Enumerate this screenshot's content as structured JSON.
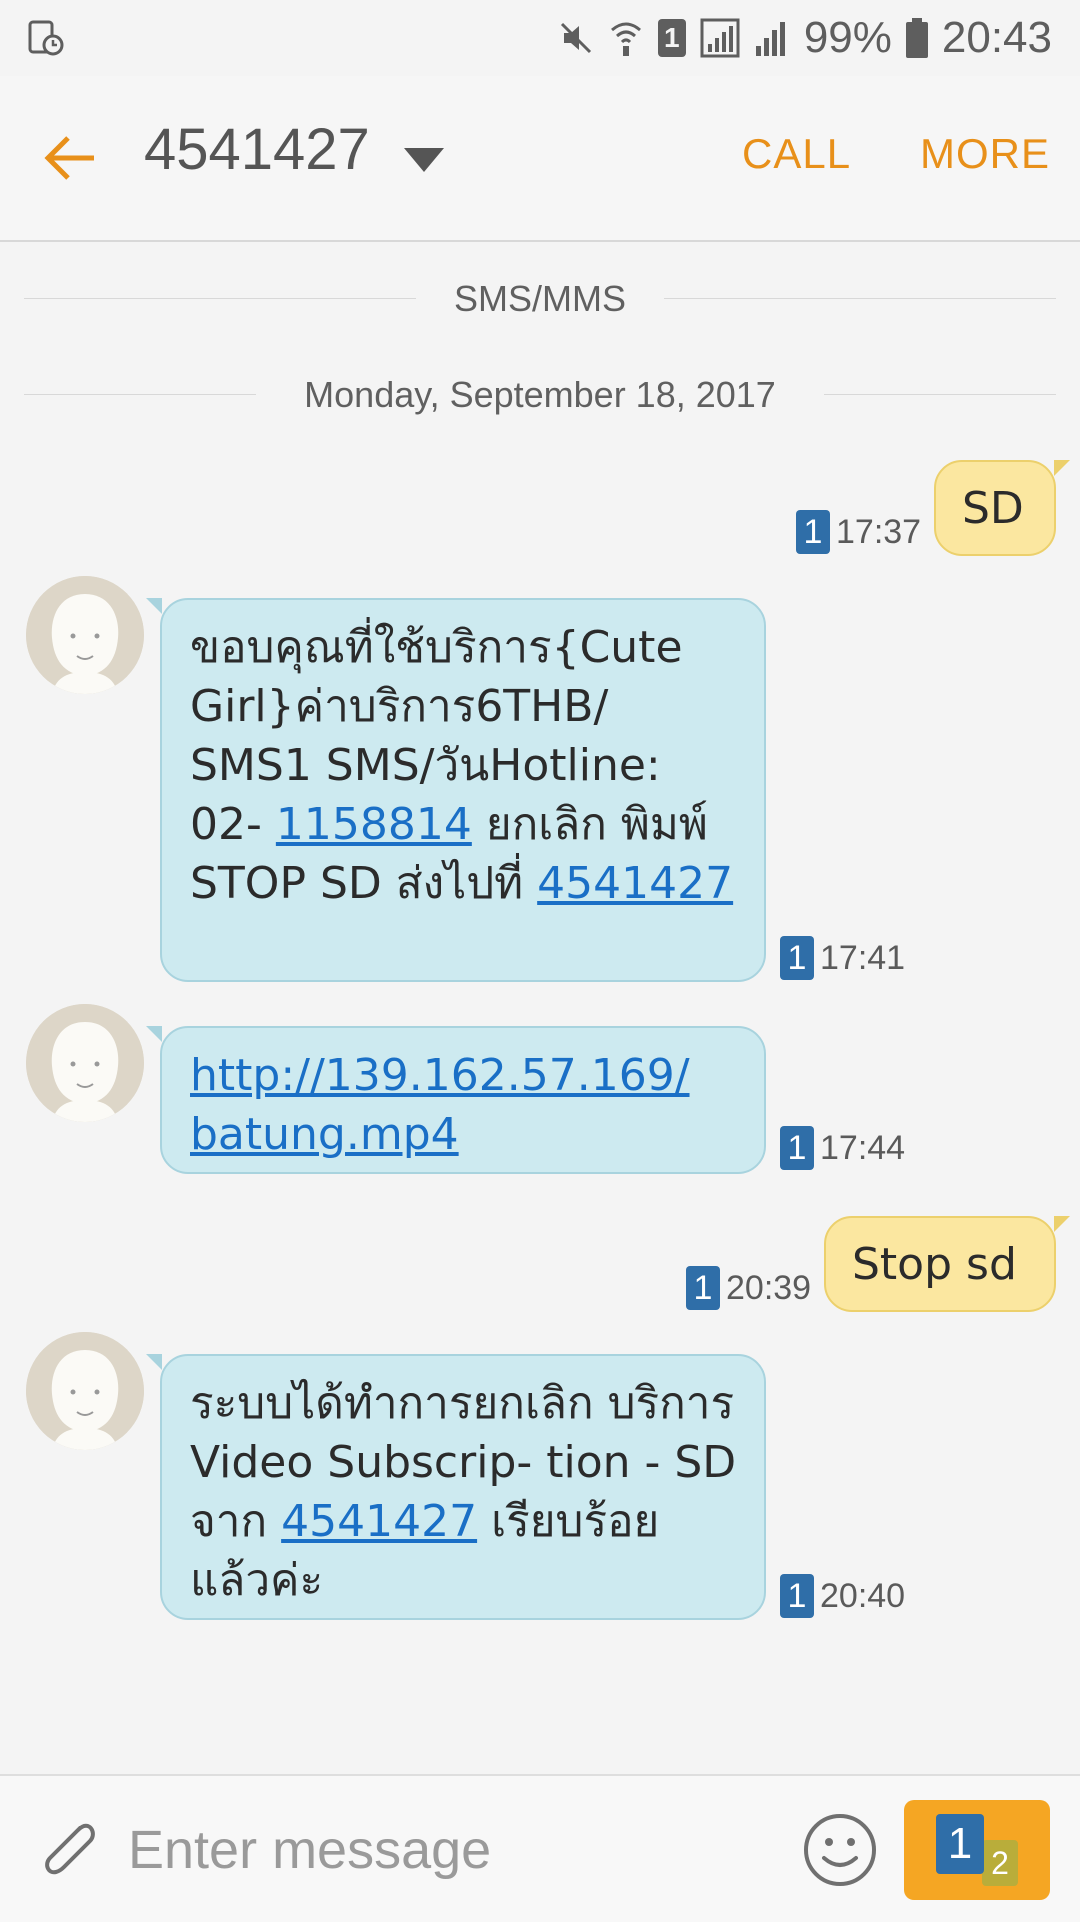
{
  "status_bar": {
    "battery": "99%",
    "time": "20:43",
    "sim_slot": "1"
  },
  "header": {
    "contact": "4541427",
    "call": "CALL",
    "more": "MORE"
  },
  "separators": {
    "channel": "SMS/MMS",
    "date": "Monday, September 18, 2017"
  },
  "messages": [
    {
      "direction": "outgoing",
      "sim": "1",
      "time": "17:37",
      "text": "SD"
    },
    {
      "direction": "incoming",
      "sim": "1",
      "time": "17:41",
      "parts": {
        "a": " ขอบคุณที่ใช้บริการ{Cute Girl}ค่าบริการ6THB/ SMS1 SMS/วันHotline: 02- ",
        "link1": "1158814",
        "b": " ยกเลิก พิมพ์ STOP SD ส่งไปที่ ",
        "link2": "4541427"
      }
    },
    {
      "direction": "incoming",
      "sim": "1",
      "time": "17:44",
      "parts": {
        "link1": "http://139.162.57.169/ batung.mp4"
      }
    },
    {
      "direction": "outgoing",
      "sim": "1",
      "time": "20:39",
      "text": "Stop sd"
    },
    {
      "direction": "incoming",
      "sim": "1",
      "time": "20:40",
      "parts": {
        "a": "ระบบได้ทำการยกเลิก บริการ Video Subscrip- tion - SD จาก ",
        "link1": "4541427",
        "b": " เรียบร้อยแล้วค่ะ"
      }
    }
  ],
  "compose": {
    "placeholder": "Enter message",
    "send_sim_primary": "1",
    "send_sim_secondary": "2"
  },
  "icons": {
    "back": "arrow-left-icon",
    "attach": "paperclip-icon",
    "emoji": "smiley-icon",
    "avatar": "default-contact-icon"
  },
  "colors": {
    "accent": "#e8901a",
    "incoming_bubble": "#cdeaf0",
    "outgoing_bubble": "#fbe7a0",
    "sim_badge": "#2f6ea8",
    "send_button": "#f5a623",
    "link": "#1a6fc6"
  }
}
